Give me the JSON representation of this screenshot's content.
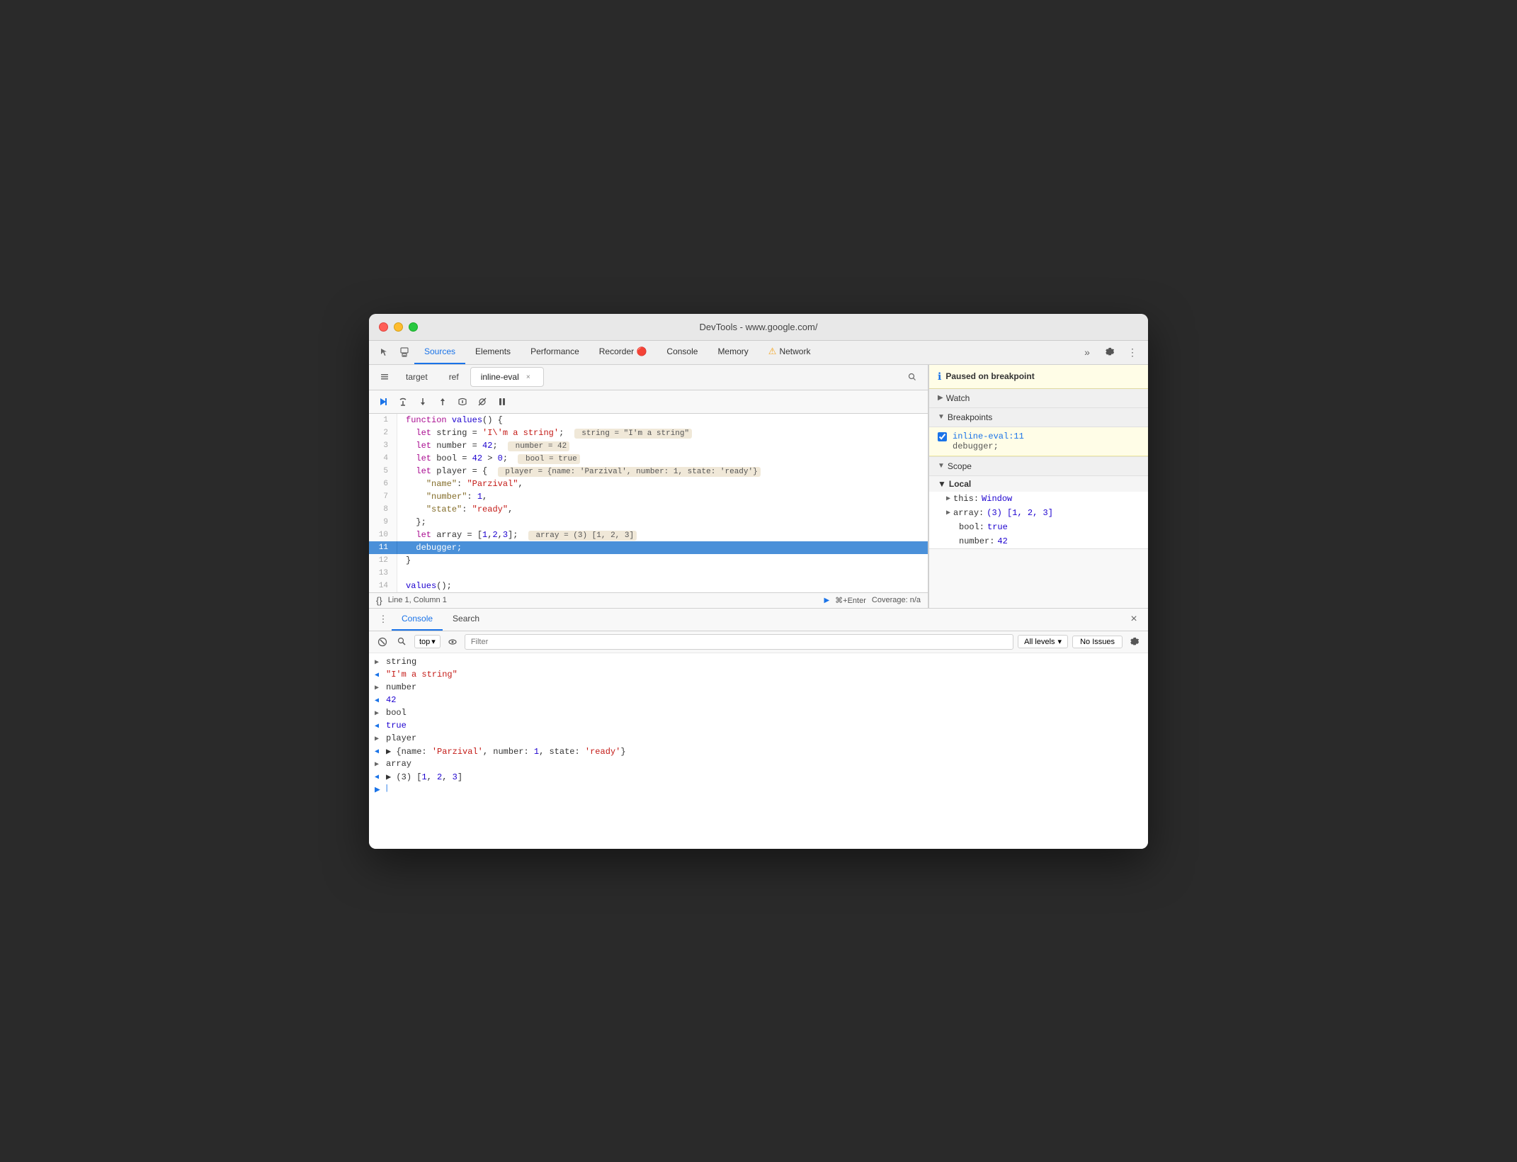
{
  "window": {
    "title": "DevTools - www.google.com/"
  },
  "titlebar": {
    "title": "DevTools - www.google.com/"
  },
  "navtabs": {
    "tabs": [
      {
        "id": "sources",
        "label": "Sources",
        "active": true
      },
      {
        "id": "elements",
        "label": "Elements",
        "active": false
      },
      {
        "id": "performance",
        "label": "Performance",
        "active": false
      },
      {
        "id": "recorder",
        "label": "Recorder 🔴",
        "active": false
      },
      {
        "id": "console",
        "label": "Console",
        "active": false
      },
      {
        "id": "memory",
        "label": "Memory",
        "active": false
      },
      {
        "id": "network",
        "label": "Network",
        "active": false
      }
    ]
  },
  "filetabs": {
    "tabs": [
      {
        "id": "target",
        "label": "target",
        "active": false,
        "closeable": false
      },
      {
        "id": "ref",
        "label": "ref",
        "active": false,
        "closeable": false
      },
      {
        "id": "inline-eval",
        "label": "inline-eval",
        "active": true,
        "closeable": true
      }
    ]
  },
  "code": {
    "lines": [
      {
        "num": 1,
        "content": "function values() {",
        "current": false
      },
      {
        "num": 2,
        "content": "  let string = 'I\\'m a string';   string = \"I'm a string\"",
        "current": false
      },
      {
        "num": 3,
        "content": "  let number = 42;   number = 42",
        "current": false
      },
      {
        "num": 4,
        "content": "  let bool = 42 > 0;   bool = true",
        "current": false
      },
      {
        "num": 5,
        "content": "  let player = {   player = {name: 'Parzival', number: 1, state: 'ready'}",
        "current": false
      },
      {
        "num": 6,
        "content": "    \"name\": \"Parzival\",",
        "current": false
      },
      {
        "num": 7,
        "content": "    \"number\": 1,",
        "current": false
      },
      {
        "num": 8,
        "content": "    \"state\": \"ready\",",
        "current": false
      },
      {
        "num": 9,
        "content": "  };",
        "current": false
      },
      {
        "num": 10,
        "content": "  let array = [1,2,3];   array = (3) [1, 2, 3]",
        "current": false
      },
      {
        "num": 11,
        "content": "  debugger;",
        "current": true
      },
      {
        "num": 12,
        "content": "}",
        "current": false
      },
      {
        "num": 13,
        "content": "",
        "current": false
      },
      {
        "num": 14,
        "content": "values();",
        "current": false
      }
    ]
  },
  "statusbar": {
    "position": "Line 1, Column 1",
    "run_label": "⌘+Enter",
    "coverage": "Coverage: n/a"
  },
  "console_tabs": {
    "tabs": [
      {
        "id": "console",
        "label": "Console",
        "active": true
      },
      {
        "id": "search",
        "label": "Search",
        "active": false
      }
    ]
  },
  "console_toolbar": {
    "top_label": "top",
    "filter_placeholder": "Filter",
    "levels_label": "All levels",
    "no_issues_label": "No Issues"
  },
  "console_output": [
    {
      "type": "input",
      "arrow": ">",
      "text": "string"
    },
    {
      "type": "output",
      "arrow": "<",
      "text": "\"I'm a string\"",
      "color": "str"
    },
    {
      "type": "input",
      "arrow": ">",
      "text": "number"
    },
    {
      "type": "output",
      "arrow": "<",
      "text": "42",
      "color": "num"
    },
    {
      "type": "input",
      "arrow": ">",
      "text": "bool"
    },
    {
      "type": "output",
      "arrow": "<",
      "text": "true",
      "color": "bool"
    },
    {
      "type": "input",
      "arrow": ">",
      "text": "player"
    },
    {
      "type": "output-obj",
      "arrow": "<",
      "text": "▶ {name: 'Parzival', number: 1, state: 'ready'}"
    },
    {
      "type": "input",
      "arrow": ">",
      "text": "array"
    },
    {
      "type": "output-obj",
      "arrow": "<",
      "text": "▶ (3) [1, 2, 3]"
    },
    {
      "type": "prompt",
      "arrow": ">",
      "text": ""
    }
  ],
  "right_panel": {
    "breakpoint_notice": "Paused on breakpoint",
    "watch_label": "Watch",
    "breakpoints_label": "Breakpoints",
    "breakpoint_file": "inline-eval:11",
    "breakpoint_code": "debugger;",
    "scope_label": "Scope",
    "local_label": "Local",
    "scope_items": [
      {
        "key": "this:",
        "value": "Window",
        "has_arrow": true
      },
      {
        "key": "array:",
        "value": "(3) [1, 2, 3]",
        "has_arrow": true
      },
      {
        "key": "bool:",
        "value": "true",
        "has_arrow": false
      },
      {
        "key": "number:",
        "value": "42",
        "has_arrow": false
      }
    ]
  }
}
